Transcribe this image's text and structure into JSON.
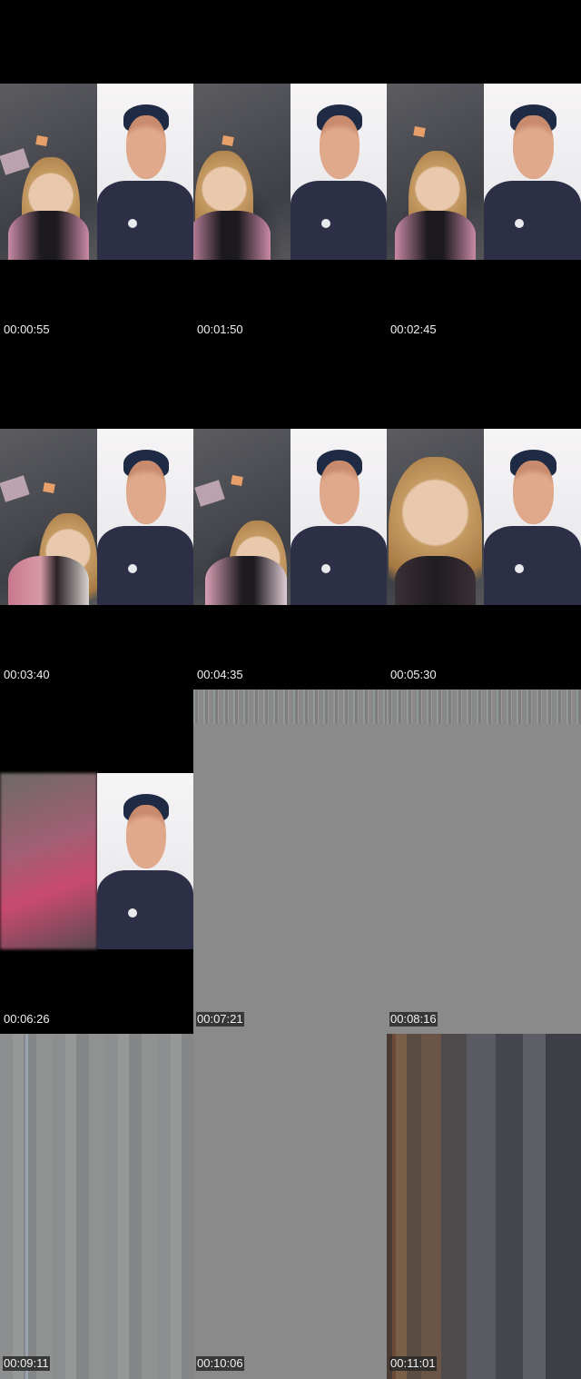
{
  "cells": [
    {
      "timestamp": "00:00:55",
      "left": "girl-room",
      "right": "man-studio"
    },
    {
      "timestamp": "00:01:50",
      "left": "girl-room",
      "right": "man-studio"
    },
    {
      "timestamp": "00:02:45",
      "left": "girl-room",
      "right": "man-studio"
    },
    {
      "timestamp": "00:03:40",
      "left": "girl-room",
      "right": "man-studio"
    },
    {
      "timestamp": "00:04:35",
      "left": "girl-room",
      "right": "man-studio"
    },
    {
      "timestamp": "00:05:30",
      "left": "girl-room",
      "right": "man-studio"
    },
    {
      "timestamp": "00:06:26",
      "left": "girl-room-blurred",
      "right": "man-studio"
    },
    {
      "timestamp": "00:07:21",
      "left": "gray-noise",
      "right": ""
    },
    {
      "timestamp": "00:08:16",
      "left": "gray-noise",
      "right": ""
    },
    {
      "timestamp": "00:09:11",
      "left": "gray-stripes",
      "right": ""
    },
    {
      "timestamp": "00:10:06",
      "left": "gray-noise",
      "right": ""
    },
    {
      "timestamp": "00:11:01",
      "left": "dark-stripes",
      "right": ""
    }
  ]
}
